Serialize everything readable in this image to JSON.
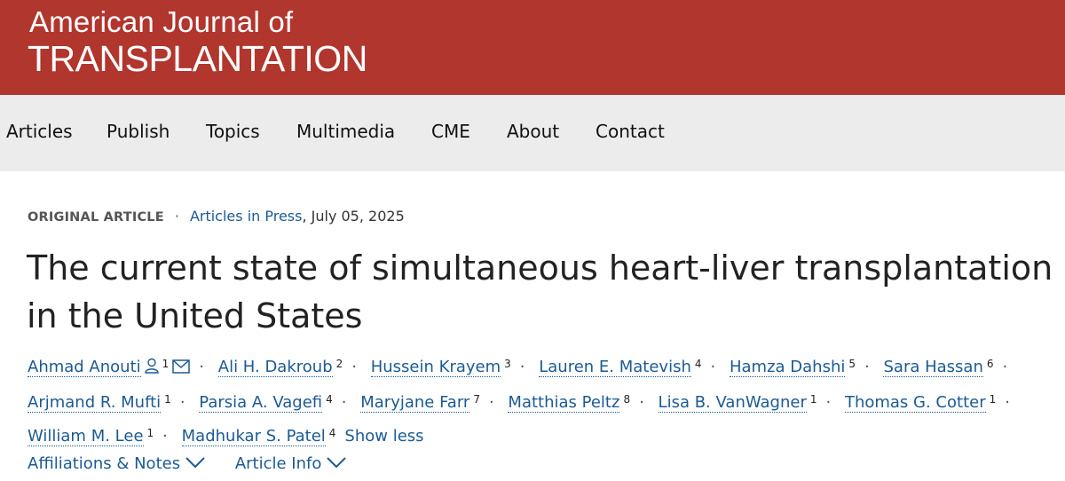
{
  "journal": {
    "name_line1": "American Journal of",
    "name_line2": "TRANSPLANTATION"
  },
  "nav": {
    "items": [
      "Articles",
      "Publish",
      "Topics",
      "Multimedia",
      "CME",
      "About",
      "Contact"
    ]
  },
  "article": {
    "type": "ORIGINAL ARTICLE",
    "status_link": "Articles in Press",
    "date": ", July 05, 2025",
    "title": "The current state of simultaneous heart-liver transplantation in the United States"
  },
  "authors": [
    {
      "name": "Ahmad Anouti",
      "aff": "1"
    },
    {
      "name": "Ali H. Dakroub",
      "aff": "2"
    },
    {
      "name": "Hussein Krayem",
      "aff": "3"
    },
    {
      "name": "Lauren E. Matevish",
      "aff": "4"
    },
    {
      "name": "Hamza Dahshi",
      "aff": "5"
    },
    {
      "name": "Sara Hassan",
      "aff": "6"
    },
    {
      "name": "Arjmand R. Mufti",
      "aff": "1"
    },
    {
      "name": "Parsia A. Vagefi",
      "aff": "4"
    },
    {
      "name": "Maryjane Farr",
      "aff": "7"
    },
    {
      "name": "Matthias Peltz",
      "aff": "8"
    },
    {
      "name": "Lisa B. VanWagner",
      "aff": "1"
    },
    {
      "name": "Thomas G. Cotter",
      "aff": "1"
    },
    {
      "name": "William M. Lee",
      "aff": "1"
    },
    {
      "name": "Madhukar S. Patel",
      "aff": "4"
    }
  ],
  "show_less": "Show less",
  "bottom_links": {
    "affiliations": "Affiliations & Notes",
    "article_info": "Article Info"
  },
  "colors": {
    "brand": "#b1362e",
    "link": "#1b5a94",
    "nav_bg": "#ececec"
  },
  "icons": [
    "person-icon",
    "envelope-icon",
    "chevron-down-icon"
  ]
}
